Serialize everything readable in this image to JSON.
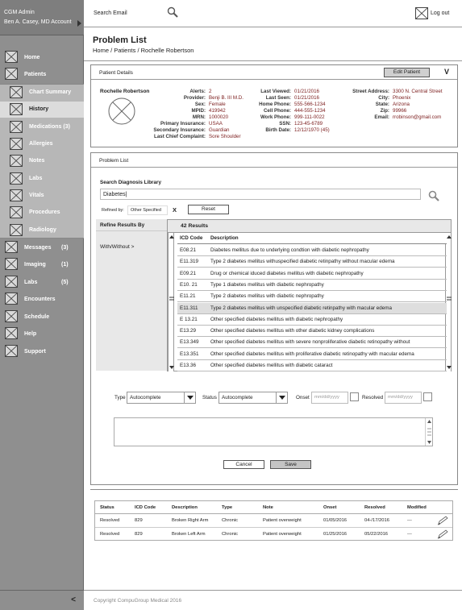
{
  "sidebar": {
    "org": "CGM Admin",
    "user": "Ben A. Casey, MD Account",
    "items": [
      {
        "label": "Home",
        "count": ""
      },
      {
        "label": "Patients",
        "count": ""
      }
    ],
    "sub_items": [
      {
        "label": "Chart Summary"
      },
      {
        "label": "History"
      },
      {
        "label": "Medications (3)"
      },
      {
        "label": "Allergies"
      },
      {
        "label": "Notes"
      },
      {
        "label": "Labs"
      },
      {
        "label": "Vitals"
      },
      {
        "label": "Procedures"
      },
      {
        "label": "Radiology"
      }
    ],
    "bottom_items": [
      {
        "label": "Messages",
        "count": "(3)"
      },
      {
        "label": "Imaging",
        "count": "(1)"
      },
      {
        "label": "Labs",
        "count": "(5)"
      },
      {
        "label": "Encounters",
        "count": ""
      },
      {
        "label": "Schedule",
        "count": ""
      },
      {
        "label": "Help",
        "count": ""
      },
      {
        "label": "Support",
        "count": ""
      }
    ],
    "collapse": "<"
  },
  "header": {
    "search_label": "Search Email",
    "logout": "Log out"
  },
  "page": {
    "title": "Problem List",
    "breadcrumb": "Home / Patients / Rochelle Robertson"
  },
  "patient_details": {
    "heading": "Patient Details",
    "edit_button": "Edit Patient",
    "collapse": "V",
    "name": "Rochelle Robertson",
    "col1": [
      {
        "k": "Alerts:",
        "v": "2"
      },
      {
        "k": "Provider:",
        "v": "Benji B. III M.D."
      },
      {
        "k": "Sex:",
        "v": "Female"
      },
      {
        "k": "MPID:",
        "v": "419942"
      },
      {
        "k": "MRN:",
        "v": "1000020"
      },
      {
        "k": "Primary Insurance:",
        "v": "USAA"
      },
      {
        "k": "Secondary Insurance:",
        "v": "Guardian"
      },
      {
        "k": "Last Chief Complaint:",
        "v": "Sore Shoulder"
      }
    ],
    "col2": [
      {
        "k": "Last Viewed:",
        "v": "01/21/2016"
      },
      {
        "k": "Last Seen:",
        "v": "01/21/2016"
      },
      {
        "k": "Home Phone:",
        "v": "555-566-1234"
      },
      {
        "k": "Cell Phone:",
        "v": "444-555-1234"
      },
      {
        "k": "Work Phone:",
        "v": "999-111-0022"
      },
      {
        "k": "SSN:",
        "v": "123-45-6789"
      },
      {
        "k": "Birth Date:",
        "v": "12/12/1970 (45)"
      }
    ],
    "col3": [
      {
        "k": "Street Address:",
        "v": "3300 N. Central Street"
      },
      {
        "k": "City:",
        "v": "Phoenix"
      },
      {
        "k": "State:",
        "v": "Arizona"
      },
      {
        "k": "Zip:",
        "v": "99966"
      },
      {
        "k": "Email:",
        "v": "rrobinson@gmail.com"
      }
    ]
  },
  "problem_list": {
    "heading": "Problem List",
    "search_label": "Search Diagnosis Library",
    "search_value": "Diabetes|",
    "refined_by_label": "Refined by:",
    "refined_by_value": "Other Specified",
    "clear_x": "X",
    "reset": "Reset",
    "refine_title": "Refine Results By",
    "refine_option": "With/Without >",
    "results_count": "42 Results",
    "col_code": "ICD Code",
    "col_desc": "Description",
    "rows": [
      {
        "code": "E08.21",
        "desc": "Diabetes mellitus due to underlying condtion with diabetic nephropathy"
      },
      {
        "code": "E11.319",
        "desc": "Type 2 diabetes mellitus withuspecified diabetic retinpathy without macular edema"
      },
      {
        "code": "E09.21",
        "desc": "Drug or chemical iduced diabetes mellitus with diabetic nephropathy"
      },
      {
        "code": "E10. 21",
        "desc": "Type 1 diabetes mellitus with diabetic nephropathy"
      },
      {
        "code": "E11.21",
        "desc": "Type 2 diabetes mellitus with diabetic nephropathy"
      },
      {
        "code": "E11.311",
        "desc": "Type 2 diabetes mellitus with unspecified diabetic retinpathy with macular edema"
      },
      {
        "code": "E 13.21",
        "desc": "Other specified diabetes mellitus with diabetic nephropathy"
      },
      {
        "code": "E13.29",
        "desc": "Other specified diabetes mellitus with other diabetic kidney complications"
      },
      {
        "code": "E13.349",
        "desc": "Other specified diabetes mellitus with severe nonproliferative diabetic retinopathy without"
      },
      {
        "code": "E13.351",
        "desc": "Other specified diabetes mellitus with proliferative diabetic retinopathy with macular edema"
      },
      {
        "code": "E13.36",
        "desc": "Other specified diabetes mellitus with diabetic cataract"
      }
    ],
    "type_label": "Type",
    "type_value": "Autocomplete",
    "status_label": "Status",
    "status_value": "Autocomplete",
    "onset_label": "Onset",
    "onset_placeholder": "mm/dd/yyyy",
    "resolved_label": "Resolved",
    "resolved_placeholder": "mm/dd/yyyy",
    "cancel": "Cancel",
    "save": "Save"
  },
  "history_table": {
    "headers": [
      "Status",
      "ICD Code",
      "Description",
      "Type",
      "Note",
      "Onset",
      "Resolved",
      "Modified"
    ],
    "rows": [
      [
        "Resolved",
        "829",
        "Broken Right Arm",
        "Chronic",
        "Patient overweight",
        "01/05/2016",
        "04-/17/2016",
        "---"
      ],
      [
        "Resolved",
        "829",
        "Broken Left Arm",
        "Chronic",
        "Patient overweight",
        "01/25/2016",
        "05/22/2016",
        "---"
      ]
    ]
  },
  "footer": {
    "copyright": "Copyright CompuGroup Medical 2016"
  }
}
